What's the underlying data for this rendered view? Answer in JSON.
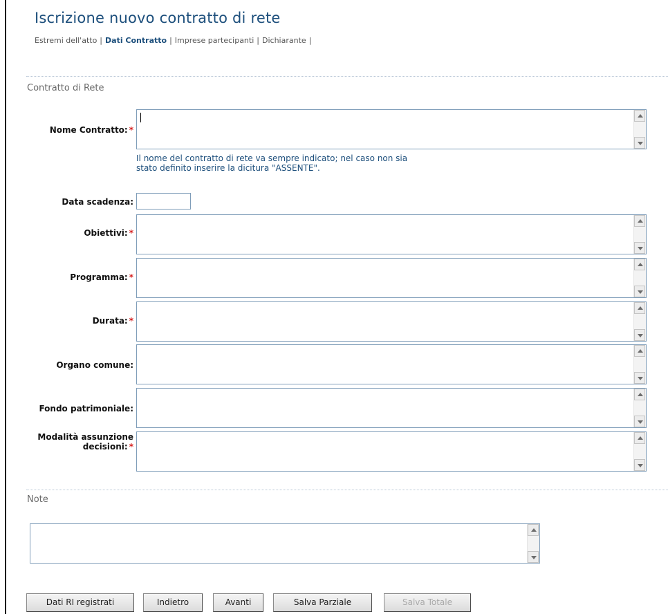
{
  "page": {
    "title": "Iscrizione nuovo contratto di rete"
  },
  "breadcrumb": {
    "items": [
      {
        "label": "Estremi dell'atto"
      },
      {
        "label": "Dati Contratto"
      },
      {
        "label": "Imprese partecipanti"
      },
      {
        "label": "Dichiarante"
      }
    ],
    "separator": "|"
  },
  "section_contratto": {
    "title": "Contratto di Rete",
    "fields": {
      "nome_contratto": {
        "label": "Nome Contratto:",
        "required": "*",
        "value": ""
      },
      "hint": {
        "line1": "Il nome del contratto di rete va sempre indicato; nel caso non sia",
        "line2": "stato definito inserire la dicitura \"ASSENTE\"."
      },
      "data_scadenza": {
        "label": "Data scadenza:",
        "value": ""
      },
      "obiettivi": {
        "label": "Obiettivi:",
        "required": "*",
        "value": ""
      },
      "programma": {
        "label": "Programma:",
        "required": "*",
        "value": ""
      },
      "durata": {
        "label": "Durata:",
        "required": "*",
        "value": ""
      },
      "organo_comune": {
        "label": "Organo comune:",
        "value": ""
      },
      "fondo_patrimoniale": {
        "label": "Fondo patrimoniale:",
        "value": ""
      },
      "modalita": {
        "label_line1": "Modalità assunzione",
        "label_line2": "decisioni:",
        "required": "*",
        "value": ""
      }
    }
  },
  "section_note": {
    "title": "Note",
    "value": ""
  },
  "buttons": {
    "dati_ri": "Dati RI registrati",
    "indietro": "Indietro",
    "avanti": "Avanti",
    "salva_parziale": "Salva Parziale",
    "salva_totale": "Salva Totale"
  },
  "colors": {
    "title": "#1d4f7c",
    "required": "#d62020",
    "field_border": "#7f9db9"
  }
}
